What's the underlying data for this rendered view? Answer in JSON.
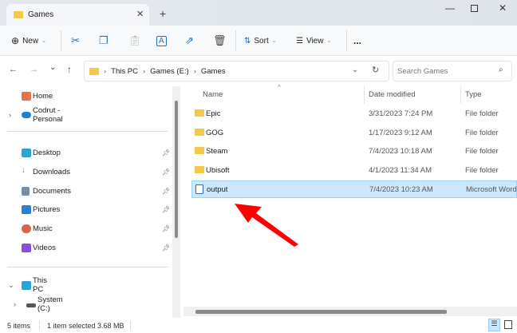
{
  "window": {
    "tab_title": "Games"
  },
  "toolbar": {
    "new": "New",
    "sort": "Sort",
    "view": "View",
    "more": "..."
  },
  "address": {
    "crumbs": [
      "This PC",
      "Games (E:)",
      "Games"
    ],
    "search_placeholder": "Search Games"
  },
  "nav": {
    "items": [
      {
        "label": "Home",
        "icon": "home-icon",
        "color": "#e8734a"
      },
      {
        "label": "Codrut - Personal",
        "icon": "cloud-icon",
        "color": "#1f7fd8"
      },
      {
        "label": "Desktop",
        "icon": "desktop-icon",
        "color": "#2fa3d6"
      },
      {
        "label": "Downloads",
        "icon": "download-icon",
        "color": "#2aa36b"
      },
      {
        "label": "Documents",
        "icon": "documents-icon",
        "color": "#7a8ea8"
      },
      {
        "label": "Pictures",
        "icon": "pictures-icon",
        "color": "#2b7fd6"
      },
      {
        "label": "Music",
        "icon": "music-icon",
        "color": "#e0604e"
      },
      {
        "label": "Videos",
        "icon": "videos-icon",
        "color": "#8a4fd8"
      },
      {
        "label": "This PC",
        "icon": "computer-icon",
        "color": "#2fa3d6"
      },
      {
        "label": "System (C:)",
        "icon": "drive-icon",
        "color": "#555555"
      }
    ]
  },
  "columns": {
    "name": "Name",
    "date": "Date modified",
    "type": "Type"
  },
  "files": [
    {
      "name": "Epic",
      "date": "3/31/2023 7:24 PM",
      "type": "File folder"
    },
    {
      "name": "GOG",
      "date": "1/17/2023 9:12 AM",
      "type": "File folder"
    },
    {
      "name": "Steam",
      "date": "7/4/2023 10:18 AM",
      "type": "File folder"
    },
    {
      "name": "Ubisoft",
      "date": "4/1/2023 11:34 AM",
      "type": "File folder"
    },
    {
      "name": "output",
      "date": "7/4/2023 10:23 AM",
      "type": "Microsoft Word",
      "selected": true
    }
  ],
  "status": {
    "items": "5 items",
    "selected": "1 item selected",
    "size": "3.68 MB"
  },
  "colors": {
    "selection": "#cce8ff",
    "annotation_arrow": "#ff0000"
  }
}
